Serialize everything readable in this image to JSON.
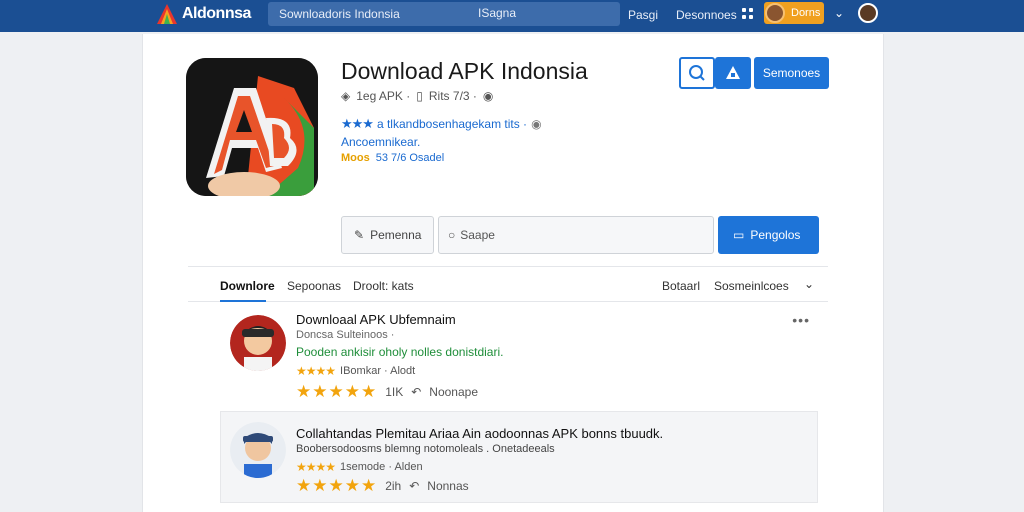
{
  "topbar": {
    "logo_text": "Aldonnsa",
    "search_text": "Sownloadoris Indonsia",
    "search_button": "ISagna",
    "links": [
      "Pasgi",
      "Desonnoes"
    ],
    "user_label": "Dorns",
    "colors": {
      "bar": "#1b4f93",
      "chip": "#f0a020"
    }
  },
  "app": {
    "title": "Download APK Indonsia",
    "meta_line1": [
      "1eg APK ·",
      "Rits 7/3 ·"
    ],
    "rating_text": "a tlkandbosenhagekam tits ·",
    "developer": "Ancoemnikear.",
    "size_label": "Moos",
    "size_text": "53 7/6 Osadel",
    "accent": "#1e74d8"
  },
  "actions": {
    "sem_label": "Semonoes",
    "pem_label": "Pemenna",
    "search_placeholder": "Saape",
    "peng_label": "Pengolos"
  },
  "tabs": {
    "left": [
      "Downlore",
      "Sepoonas",
      "Droolt: kats"
    ],
    "right": [
      "Botaarl",
      "Sosmeinlcoes"
    ]
  },
  "reviews": [
    {
      "title": "Downloaal APK Ubfemnaim",
      "sub": "Doncsa Sulteinoos ·",
      "body": "Pooden ankisir oholy nolles donistdiari.",
      "small_rating": "IBomkar · Alodt",
      "count": "1IK",
      "reply_label": "Noonape"
    },
    {
      "title": "Collahtandas Plemitau Ariaa Ain aodoonnas APK bonns tbuudk.",
      "sub": "Boobersodoosms blemng notomoleals . Onetadeeals",
      "body": "",
      "small_rating": "1semode · Alden",
      "count": "2ih",
      "reply_label": "Nonnas"
    }
  ]
}
